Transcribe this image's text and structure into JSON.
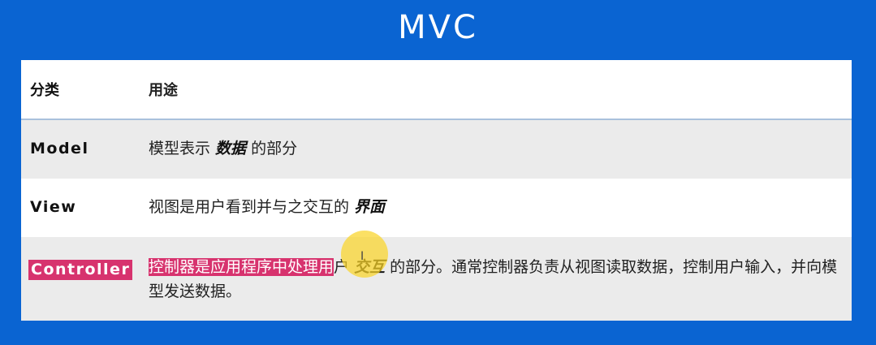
{
  "slide": {
    "title": "MVC"
  },
  "table": {
    "headers": [
      "分类",
      "用途"
    ],
    "rows": [
      {
        "name": "Model",
        "desc_prefix": "模型表示 ",
        "desc_emph": "数据",
        "desc_suffix": " 的部分"
      },
      {
        "name": "View",
        "desc_prefix": "视图是用户看到并与之交互的 ",
        "desc_emph": "界面"
      },
      {
        "name": "Controller",
        "desc_highlight": "控制器是应用程序中处理用",
        "desc_after_highlight": "户 ",
        "desc_emph": "交互",
        "desc_suffix": " 的部分。通常控制器负责从视图读取数据，控制用户输入，并向模型发送数据。"
      }
    ]
  },
  "cursor": {
    "icon": "text-cursor-icon",
    "highlight_color": "#f8d12a"
  },
  "colors": {
    "background": "#0a64d2",
    "highlight": "#d7336e"
  }
}
